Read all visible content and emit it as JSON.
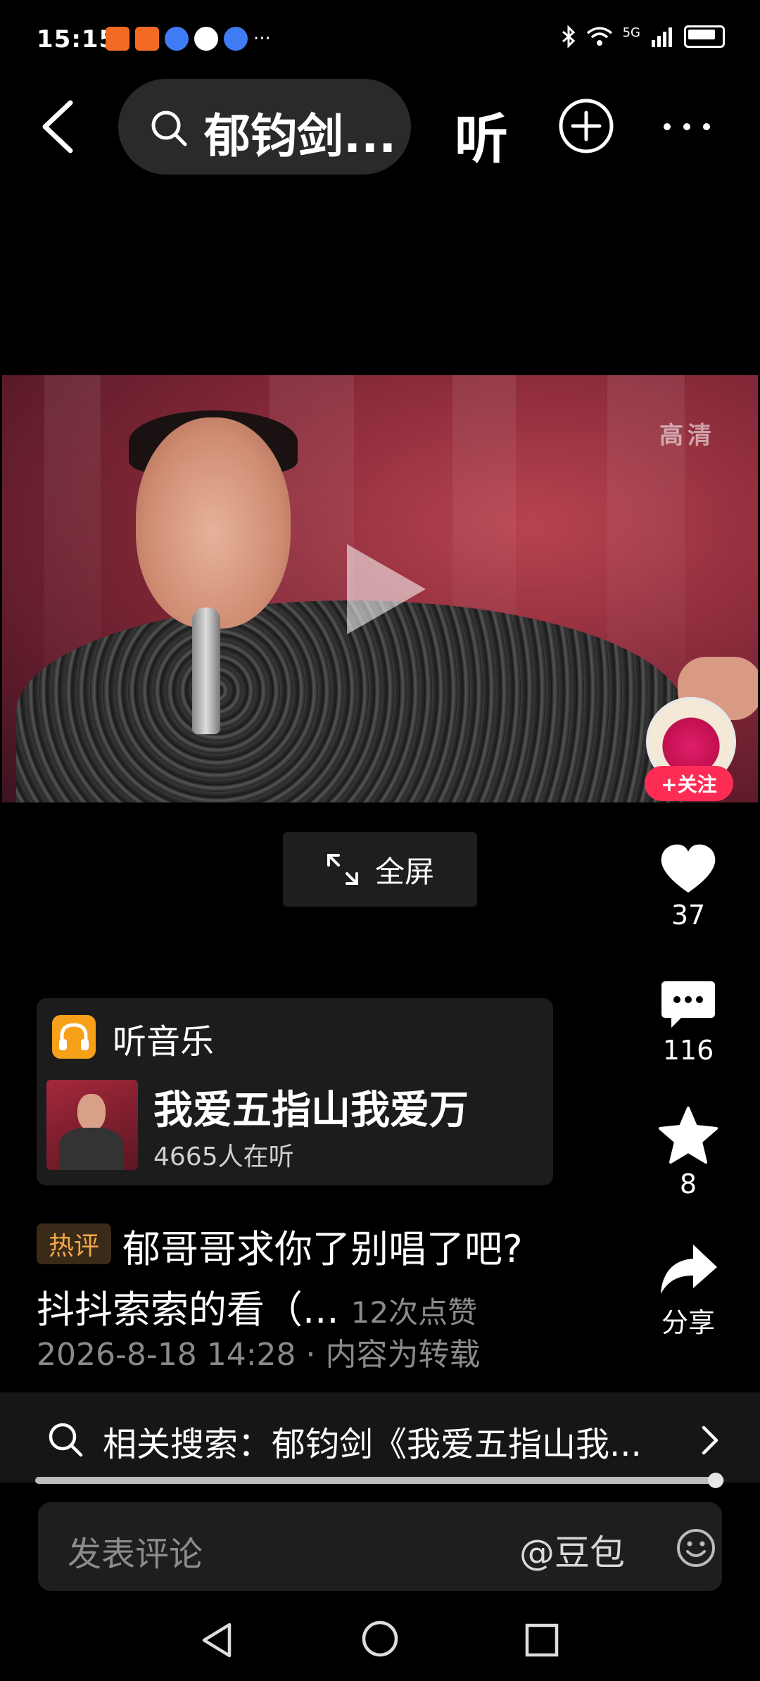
{
  "status_bar": {
    "time": "15:15",
    "network": "5G",
    "app_icon_colors": [
      "#f36b22",
      "#f36b22",
      "#3e7bf5",
      "#ffffff",
      "#3e7bf5"
    ]
  },
  "nav": {
    "search_text": "郁钧剑...",
    "listen_label": "听"
  },
  "video": {
    "hd_label": "高清",
    "follow_label": "+关注",
    "fullscreen_label": "全屏"
  },
  "actions": {
    "likes": "37",
    "comments": "116",
    "favorites": "8",
    "share_label": "分享"
  },
  "music": {
    "section_label": "听音乐",
    "song_title": "我爱五指山我爱万",
    "listeners": "4665人在听"
  },
  "hot_comment": {
    "badge": "热评",
    "line1": "郁哥哥求你了别唱了吧?",
    "line2": "抖抖索索的看（...",
    "likes": "12次点赞",
    "meta": "2026-8-18 14:28 · 内容为转载"
  },
  "related": {
    "text": "相关搜索：郁钧剑《我爱五指山我...",
    "progress_fraction": 0.987
  },
  "comment_input": {
    "placeholder": "发表评论",
    "mention": "@豆包"
  },
  "colors": {
    "accent_red": "#fe2c55",
    "music_badge": "#f7a11b",
    "hot_badge_text": "#f3a64a"
  }
}
